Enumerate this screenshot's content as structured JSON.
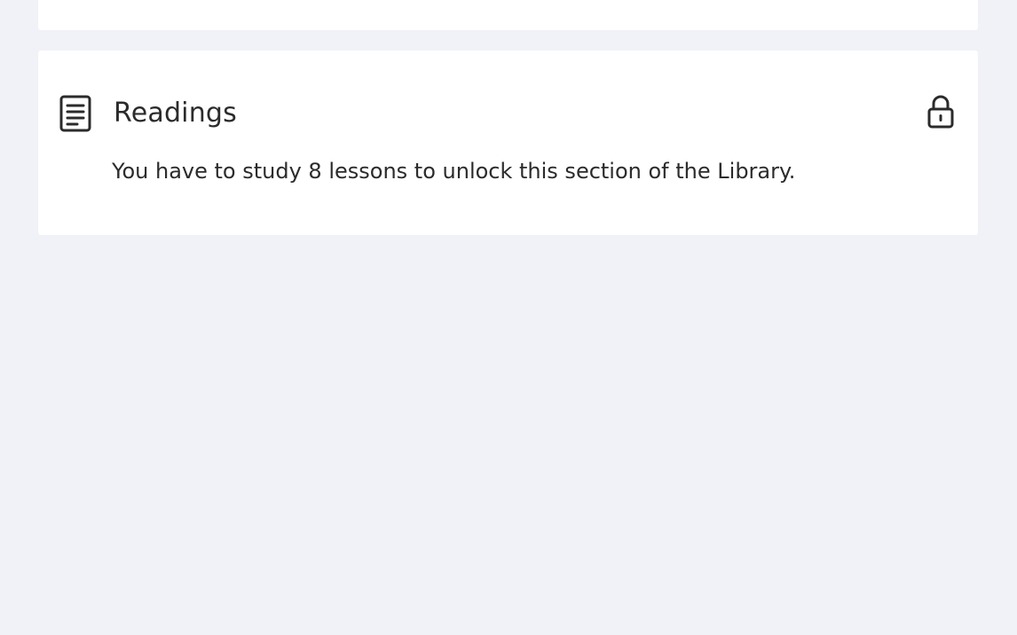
{
  "readings_card": {
    "icon": "document-icon",
    "title": "Readings",
    "lock_icon": "lock-icon",
    "message": "You have to study 8 lessons to unlock this section of the Library."
  },
  "colors": {
    "page_background": "#f0f2f7",
    "card_background": "#ffffff",
    "text": "#2b2b2b"
  }
}
